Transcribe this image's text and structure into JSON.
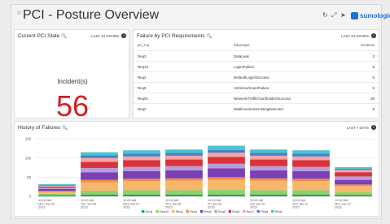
{
  "header": {
    "title": "PCI - Posture Overview",
    "brand": "sumologic",
    "brand_color": "#1e6fd9",
    "icons": [
      "star-icon",
      "refresh-icon",
      "fullscreen-icon",
      "share-icon"
    ]
  },
  "state_panel": {
    "title": "Current PCI State",
    "range": "LAST 24 HOURS",
    "label": "Incident(s)",
    "value": "56",
    "value_color": "#d21f1f"
  },
  "failures_panel": {
    "title": "Failure by PCI Requirements",
    "range": "LAST 24 HOURS",
    "columns": [
      "pci_req",
      "failuretype",
      "incidents"
    ],
    "rows": [
      [
        "Req3",
        "DataLeak",
        "3"
      ],
      [
        "Req10",
        "Login/Failure",
        "9"
      ],
      [
        "Req2",
        "Default/Login/Success",
        "6"
      ],
      [
        "Req5",
        "AntiVirus/Scan/Failure",
        "5"
      ],
      [
        "Req01",
        "Network/Traffic/Cardholder/Success",
        "28"
      ],
      [
        "Req2",
        "MultiFunctionsHostingDetected",
        "8"
      ]
    ]
  },
  "history_panel": {
    "title": "History of Failures",
    "range": "LAST 7 DAYS"
  },
  "chart_data": {
    "type": "bar",
    "stacked": true,
    "title": "History of Failures",
    "ylim": [
      0,
      150
    ],
    "yticks": [
      0,
      50,
      100,
      150
    ],
    "grid": true,
    "legend_position": "bottom",
    "categories": [
      "12:00 AM|Mon Jan 05|2015",
      "12:00 AM|Tue Jan 06|2015",
      "12:00 AM|Wed Jan 07|2015",
      "12:00 AM|Thu Jan 08|2015",
      "12:00 AM|Fri Jan 09|2015",
      "12:00 AM|Sat Jan 10|2015",
      "12:00 AM|Sun Jan 11|2015",
      "12:00 AM|Mon Jan 12|2015"
    ],
    "series": [
      {
        "name": "Req1",
        "color": "#2ca05a",
        "values": [
          3,
          5,
          5,
          5,
          5,
          5,
          5,
          4
        ]
      },
      {
        "name": "Req10",
        "color": "#8fd16a",
        "values": [
          4,
          10,
          11,
          11,
          12,
          11,
          11,
          7
        ]
      },
      {
        "name": "Req2",
        "color": "#f7b76b",
        "values": [
          5,
          22,
          24,
          25,
          26,
          25,
          24,
          16
        ]
      },
      {
        "name": "Req3",
        "color": "#f28c3c",
        "values": [
          2,
          6,
          6,
          6,
          7,
          6,
          6,
          4
        ]
      },
      {
        "name": "Req4",
        "color": "#7b3fb5",
        "values": [
          5,
          20,
          20,
          21,
          23,
          21,
          20,
          12
        ]
      },
      {
        "name": "Req5",
        "color": "#b79ed8",
        "values": [
          3,
          11,
          11,
          11,
          12,
          11,
          11,
          9
        ]
      },
      {
        "name": "Req6",
        "color": "#d9323a",
        "values": [
          3,
          16,
          17,
          17,
          18,
          17,
          17,
          11
        ]
      },
      {
        "name": "Req7",
        "color": "#f4a3a8",
        "values": [
          2,
          10,
          10,
          10,
          11,
          10,
          10,
          6
        ]
      },
      {
        "name": "Req8",
        "color": "#4a7fc2",
        "values": [
          2,
          7,
          7,
          7,
          7,
          7,
          7,
          3
        ]
      },
      {
        "name": "Req9",
        "color": "#49c3d1",
        "values": [
          3,
          8,
          9,
          9,
          11,
          9,
          9,
          4
        ]
      }
    ]
  }
}
